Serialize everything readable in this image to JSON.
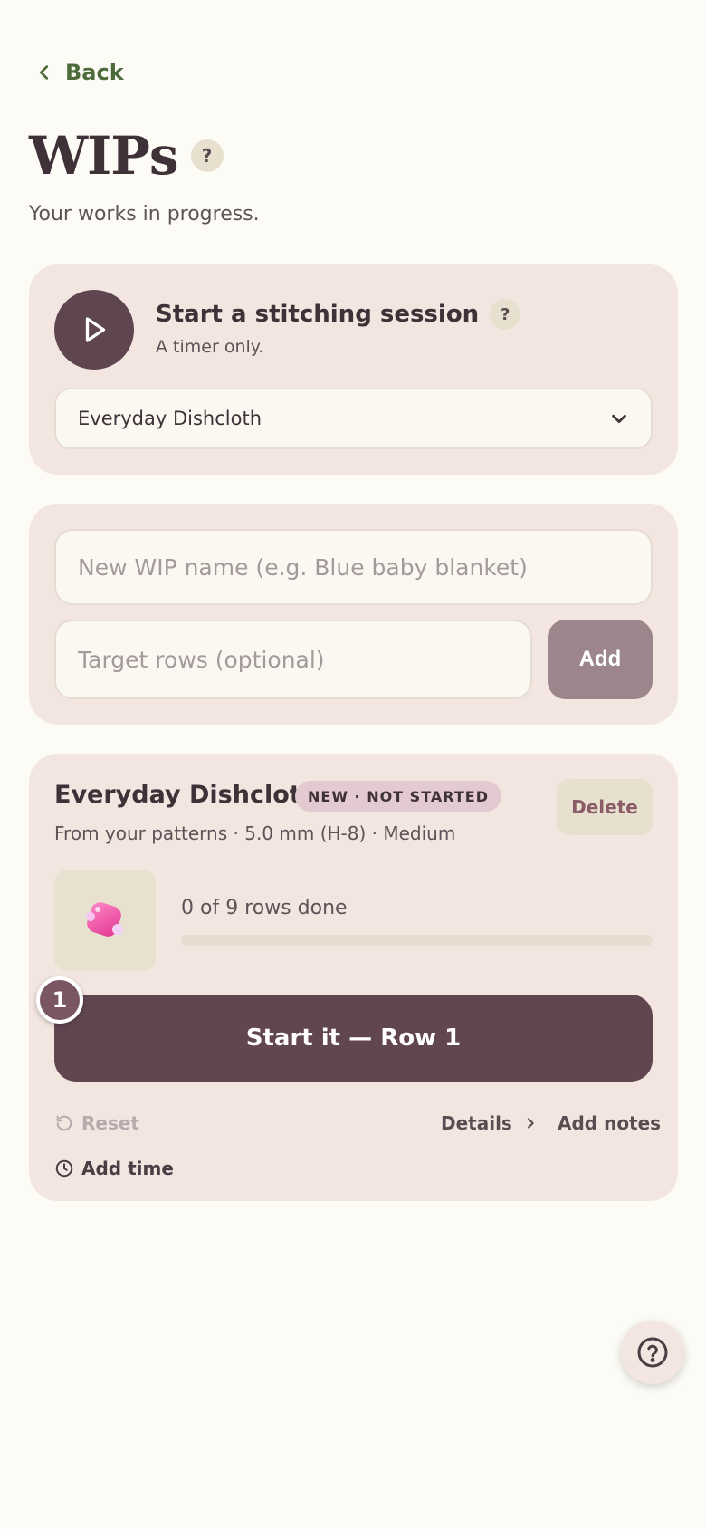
{
  "nav": {
    "back_label": "Back"
  },
  "header": {
    "title": "WIPs",
    "help_glyph": "?",
    "subtitle": "Your works in progress."
  },
  "session": {
    "title": "Start a stitching session",
    "help_glyph": "?",
    "subtitle": "A timer only.",
    "selected_pattern": "Everyday Dishcloth"
  },
  "add_form": {
    "name_placeholder": "New WIP name (e.g. Blue baby blanket)",
    "name_value": "",
    "target_placeholder": "Target rows (optional)",
    "target_value": "",
    "add_label": "Add"
  },
  "wip": {
    "name": "Everyday Dishcloth",
    "badge": "NEW · NOT STARTED",
    "delete_label": "Delete",
    "meta": "From your patterns · 5.0 mm (H-8) · Medium",
    "progress_text": "0 of 9 rows done",
    "progress_fraction": 0,
    "start_label": "Start it — Row 1",
    "step_number": "1",
    "reset_label": "Reset",
    "details_label": "Details",
    "add_notes_label": "Add notes",
    "add_time_label": "Add time"
  },
  "colors": {
    "background": "#fdfbf5",
    "card": "#f3e6e0",
    "primary": "#614651",
    "accent_green": "#4d6b3b",
    "badge": "#e3c9d0"
  },
  "icons": {
    "back": "chevron-left-icon",
    "play": "play-icon",
    "select": "chevron-down-icon",
    "reset": "reset-icon",
    "details": "chevron-right-icon",
    "time": "clock-icon",
    "help": "help-circle-icon",
    "thumb": "yarn-gem-icon"
  }
}
